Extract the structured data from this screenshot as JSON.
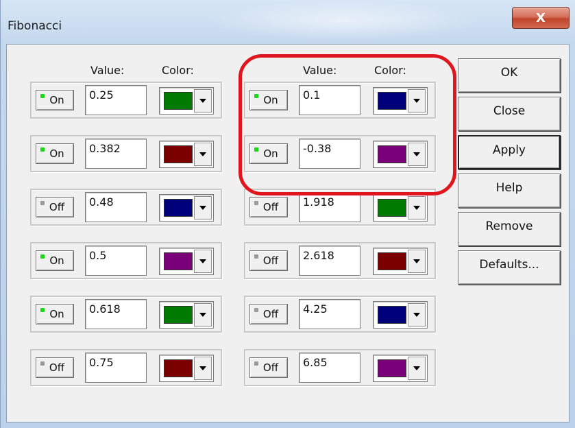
{
  "window": {
    "title": "Fibonacci",
    "close_glyph": "X"
  },
  "columns": {
    "left": {
      "value_header": "Value:",
      "color_header": "Color:"
    },
    "right": {
      "value_header": "Value:",
      "color_header": "Color:"
    }
  },
  "left_rows": [
    {
      "state": "On",
      "value": "0.25",
      "color": "#007a00"
    },
    {
      "state": "On",
      "value": "0.382",
      "color": "#7a0000"
    },
    {
      "state": "Off",
      "value": "0.48",
      "color": "#00007a"
    },
    {
      "state": "On",
      "value": "0.5",
      "color": "#7a007a"
    },
    {
      "state": "On",
      "value": "0.618",
      "color": "#007a00"
    },
    {
      "state": "Off",
      "value": "0.75",
      "color": "#7a0000"
    }
  ],
  "right_rows": [
    {
      "state": "On",
      "value": "0.1",
      "color": "#00007a"
    },
    {
      "state": "On",
      "value": "-0.38",
      "color": "#7a007a"
    },
    {
      "state": "Off",
      "value": "1.918",
      "color": "#007a00"
    },
    {
      "state": "Off",
      "value": "2.618",
      "color": "#7a0000"
    },
    {
      "state": "Off",
      "value": "4.25",
      "color": "#00007a"
    },
    {
      "state": "Off",
      "value": "6.85",
      "color": "#7a007a"
    }
  ],
  "buttons": {
    "ok": "OK",
    "close": "Close",
    "apply": "Apply",
    "help": "Help",
    "remove": "Remove",
    "defaults": "Defaults..."
  },
  "colors": {
    "highlight": "#e0151d",
    "on_led": "#18d818",
    "off_led": "#9a9a9a"
  }
}
